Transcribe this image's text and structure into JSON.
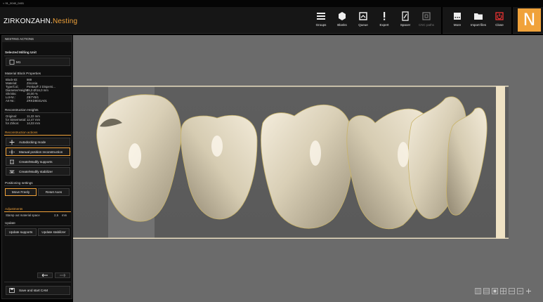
{
  "window": {
    "title": "< 91_0040_0401"
  },
  "app": {
    "brand_main": "ZIRKONZAHN.",
    "brand_accent": "Nesting",
    "logo_letter": "N"
  },
  "toolbar": {
    "groups": "Groups",
    "blanks": "Blanks",
    "queue": "Queue",
    "expert": "Expert",
    "spacer": "Spacer",
    "cnc_paths": "CNC paths",
    "more": "More",
    "import_files": "Import files",
    "close": "Close"
  },
  "sidebar": {
    "header": "NESTING ACTIONS",
    "milling_unit_title": "Selected Milling Unit",
    "milling_unit_value": "M1",
    "material_title": "Material Block Properties",
    "material": [
      {
        "k": "Block-ID:",
        "v": "989"
      },
      {
        "k": "Material:",
        "v": "Zirconia"
      },
      {
        "k": "Type/Col.:",
        "v": "Prettau® 2 Dispersi..."
      },
      {
        "k": "Diameter/Height:",
        "v": "95,0  Ø/16,0  mm"
      },
      {
        "k": "Shrinks:",
        "v": "20,00 %"
      },
      {
        "k": "Lot-Nr.:",
        "v": "ZB7YB/1"
      },
      {
        "k": "Art-Nr.:",
        "v": "ZRKD8031A01"
      }
    ],
    "recon_heights_title": "Reconstruction Heights",
    "heights": [
      {
        "k": "Original:",
        "v": "11,22 mm"
      },
      {
        "k": "for Sintermetal:",
        "v": "12,47 mm"
      },
      {
        "k": "for Zirkon:",
        "v": "14,03 mm"
      }
    ],
    "recon_actions_title": "Reconstruction actions",
    "actions": {
      "autodocking": "Autodocking mode",
      "manual_position": "Manual position reconstruction",
      "supports": "Create/Modify supports",
      "stabilizer": "Create/Modify stabilizer"
    },
    "positioning_title": "Positioning settings",
    "move_freely": "Move Freely",
    "reset_axes": "Reset Axes",
    "adjustments_title": "Adjustments",
    "stamp_label": "Stamp out material space",
    "stamp_value": "2,5",
    "stamp_unit": "mm",
    "update_title": "Update",
    "update_supports": "Update supports",
    "update_stabilizer": "Update stabilizer",
    "save_cam": "Save and start CAM"
  },
  "colors": {
    "accent": "#f0a23a",
    "canvas": "#6b6b6b",
    "panel": "#101010"
  }
}
